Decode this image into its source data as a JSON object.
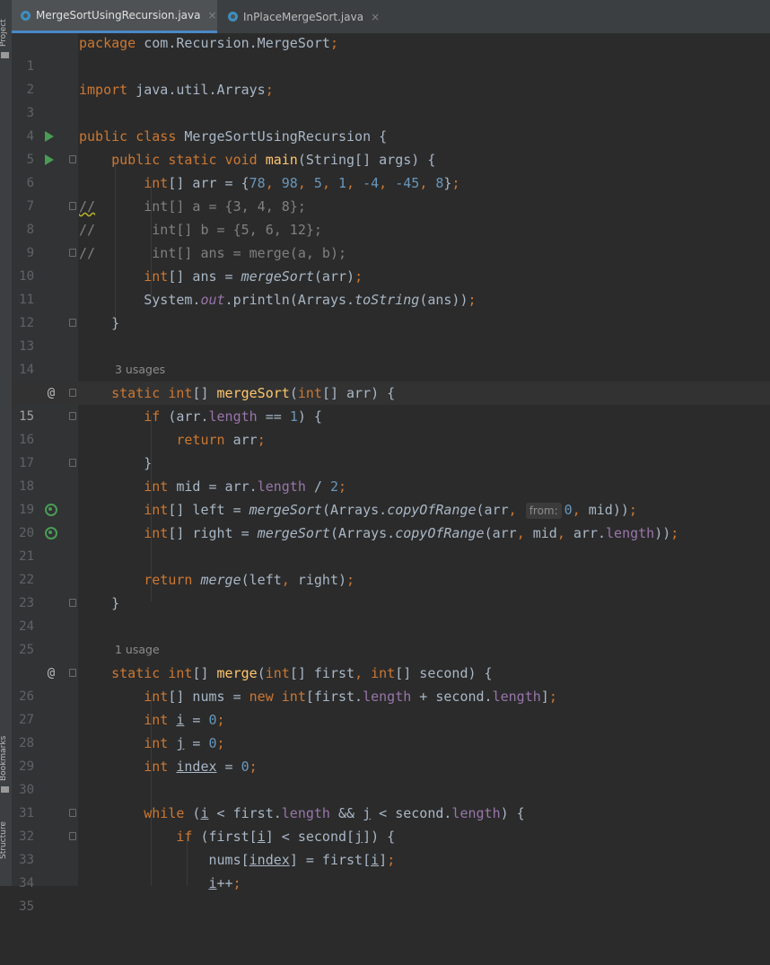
{
  "sidebar": {
    "project_label": "Project",
    "bookmarks_label": "Bookmarks",
    "structure_label": "Structure"
  },
  "tabs": [
    {
      "label": "MergeSortUsingRecursion.java",
      "active": true,
      "close": "×"
    },
    {
      "label": "InPlaceMergeSort.java",
      "active": false,
      "close": "×"
    }
  ],
  "editor": {
    "current_line": 15,
    "usages": {
      "merge_sort": "3 usages",
      "merge": "1 usage"
    },
    "hints": {
      "from_param": "from:"
    },
    "gutter_markers": {
      "override": "@"
    },
    "line_numbers": [
      "1",
      "2",
      "3",
      "4",
      "5",
      "6",
      "7",
      "8",
      "9",
      "10",
      "11",
      "12",
      "13",
      "14",
      "15",
      "16",
      "17",
      "18",
      "19",
      "20",
      "21",
      "22",
      "23",
      "24",
      "25",
      "26",
      "27",
      "28",
      "29",
      "30",
      "31",
      "32",
      "33",
      "34",
      "35"
    ]
  },
  "colors": {
    "background": "#2b2b2b",
    "gutter": "#313335",
    "keyword": "#cc7832",
    "number": "#6897bb",
    "field": "#9876aa",
    "method_decl": "#ffc66d",
    "comment": "#808080",
    "text": "#a9b7c6",
    "run_icon": "#499c54",
    "tab_accent": "#4a88c7"
  },
  "code": {
    "l1": {
      "kw": "package",
      "rest": " com.Recursion.MergeSort",
      "semi": ";"
    },
    "l3": {
      "kw": "import",
      "rest": " java.util.Arrays",
      "semi": ";"
    },
    "l5": {
      "kw1": "public",
      "kw2": "class",
      "name": " MergeSortUsingRecursion {"
    },
    "l6": {
      "kw1": "public",
      "kw2": "static",
      "kw3": "void",
      "fn": "main",
      "rest": "(String[] args) {"
    },
    "l7": {
      "type": "int",
      "a": "[] arr = {",
      "n1": "78",
      "n2": "98",
      "n3": "5",
      "n4": "1",
      "n5": "-4",
      "n6": "-45",
      "n7": "8",
      "end": "}"
    },
    "l8": {
      "slashes": "//",
      "text": "      int[] a = {3, 4, 8};"
    },
    "l9": {
      "text": "//       int[] b = {5, 6, 12};"
    },
    "l10": {
      "text": "//       int[] ans = merge(a, b);"
    },
    "l11": {
      "type": "int",
      "a": "[] ans = ",
      "call": "mergeSort",
      "b": "(arr)"
    },
    "l12": {
      "a": "System.",
      "out": "out",
      "b": ".println(Arrays.",
      "call": "toString",
      "c": "(ans))"
    },
    "l13": {
      "brace": "}"
    },
    "l15": {
      "kw": "static",
      "type": "int",
      "a": "[] ",
      "fn": "mergeSort",
      "b": "(",
      "type2": "int",
      "c": "[] arr) {"
    },
    "l16": {
      "kw": "if",
      "a": " (arr.",
      "fld": "length",
      "b": " == ",
      "num": "1",
      "c": ") {"
    },
    "l17": {
      "kw": "return",
      "a": " arr"
    },
    "l18": {
      "brace": "}"
    },
    "l19": {
      "type": "int",
      "a": " mid = arr.",
      "fld": "length",
      "b": " / ",
      "num": "2"
    },
    "l20": {
      "type": "int",
      "a": "[] left = ",
      "call": "mergeSort",
      "b": "(Arrays.",
      "call2": "copyOfRange",
      "c": "(arr",
      "num": "0",
      "d": " mid))"
    },
    "l21": {
      "type": "int",
      "a": "[] right = ",
      "call": "mergeSort",
      "b": "(Arrays.",
      "call2": "copyOfRange",
      "c": "(arr",
      "d": " mid",
      "e": " arr.",
      "fld": "length",
      "f": "))"
    },
    "l23": {
      "kw": "return",
      "call": "merge",
      "a": "(left",
      "b": " right)"
    },
    "l24": {
      "brace": "}"
    },
    "l26": {
      "kw": "static",
      "type": "int",
      "a": "[] ",
      "fn": "merge",
      "b": "(",
      "type2": "int",
      "c": "[] first",
      "type3": "int",
      "d": "[] second) {"
    },
    "l27": {
      "type": "int",
      "a": "[] nums = ",
      "kw": "new",
      "type2": "int",
      "b": "[first.",
      "fld": "length",
      "c": " + second.",
      "fld2": "length",
      "d": "]"
    },
    "l28": {
      "type": "int",
      "var": "i",
      "a": " = ",
      "num": "0"
    },
    "l29": {
      "type": "int",
      "var": "j",
      "a": " = ",
      "num": "0"
    },
    "l30": {
      "type": "int",
      "var": "index",
      "a": " = ",
      "num": "0"
    },
    "l32": {
      "kw": "while",
      "a": " (",
      "v1": "i",
      "b": " < first.",
      "fld": "length",
      "c": " && ",
      "v2": "j",
      "d": " < second.",
      "fld2": "length",
      "e": ") {"
    },
    "l33": {
      "kw": "if",
      "a": " (first[",
      "v1": "i",
      "b": "] < second[",
      "v2": "j",
      "c": "]) {"
    },
    "l34": {
      "a": "nums[",
      "v1": "index",
      "b": "] = first[",
      "v2": "i",
      "c": "]"
    },
    "l35": {
      "v": "i",
      "op": "++"
    }
  }
}
